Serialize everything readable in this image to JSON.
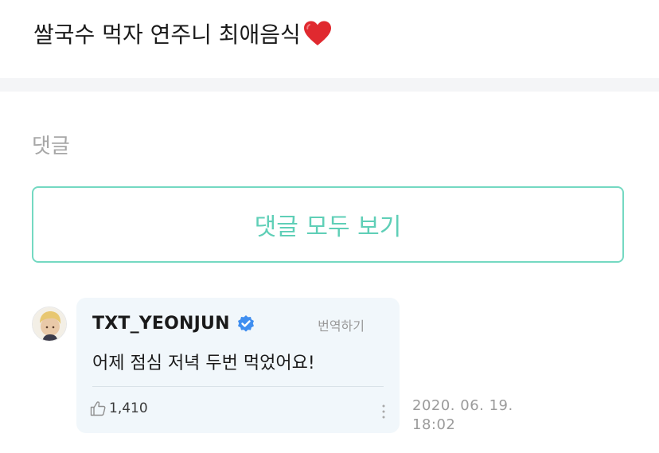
{
  "post": {
    "text": "쌀국수 먹자 연주니 최애음식",
    "emoji": "heart-icon",
    "heart_color": "#e0292f"
  },
  "comments_section": {
    "title": "댓글",
    "view_all_label": "댓글 모두 보기",
    "accent_color": "#74d9c2"
  },
  "comment": {
    "author": "TXT_YEONJUN",
    "verified_icon": "verified-badge-icon",
    "verified_color": "#3f8ef0",
    "translate_label": "번역하기",
    "body": "어제 점심 저녁 두번 먹었어요!",
    "like_icon": "thumbs-up-icon",
    "like_count": "1,410",
    "more_icon": "more-vertical-icon",
    "date": "2020. 06. 19.",
    "time": "18:02",
    "avatar_icon": "avatar-image"
  }
}
